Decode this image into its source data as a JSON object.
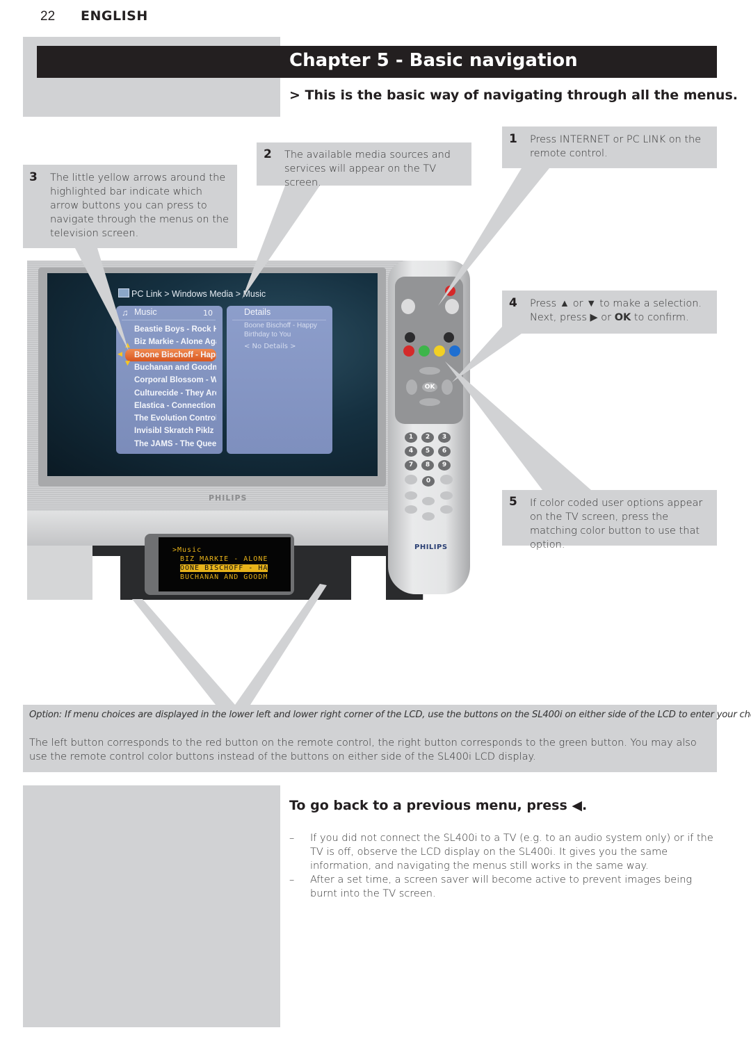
{
  "header": {
    "page_number": "22",
    "language": "ENGLISH"
  },
  "chapter": {
    "title": "Chapter 5 - Basic navigation",
    "intro": "> This is the basic way of navigating through all the menus."
  },
  "callouts": [
    {
      "number": "1",
      "text": "Press INTERNET or PC LINK on the remote control."
    },
    {
      "number": "2",
      "text": "The available media sources and services will appear on the TV screen."
    },
    {
      "number": "3",
      "text": "The little yellow arrows around the highlighted bar indicate which arrow buttons you can press to navigate through the menus on the television screen."
    },
    {
      "number": "4",
      "text_before": "Press ▲ or ▼ to make a selection. Next, press ▶ or ",
      "text_bold": "OK",
      "text_after": " to confirm."
    },
    {
      "number": "5",
      "text": "If color coded user options appear on the TV screen, press the matching color button to use that option."
    }
  ],
  "tv_screen": {
    "breadcrumb": "PC Link > Windows Media > Music",
    "menu_title": "Music",
    "menu_count": "10",
    "menu_items": [
      "Beastie Boys - Rock Hard",
      "Biz Markie - Alone Again",
      "Boone Bischoff - Happy",
      "Buchanan and Goodman",
      "Corporal Blossom - White",
      "Culturecide - They Aren't",
      "Elastica - Connection",
      "The Evolution Control Co",
      "Invisibl Skratch Piklz - u",
      "The JAMS - The Queen an"
    ],
    "selected_index": 2,
    "details_title": "Details",
    "details_text": "Boone Bischoff - Happy Birthday to You",
    "details_none": "< No Details >",
    "tv_brand": "PHILIPS"
  },
  "lcd": {
    "title": ">Music",
    "lines": [
      "BIZ MARKIE - ALONE",
      "OONE BISCHOFF - HA",
      "BUCHANAN AND GOODM"
    ],
    "selected_index": 1
  },
  "remote": {
    "brand": "PHILIPS",
    "button_colors": [
      "#d42a2a",
      "#3db54a",
      "#f2d024",
      "#1f6fd1"
    ],
    "power_color": "#d62828",
    "ok_label": "OK",
    "number_keys": [
      "1",
      "2",
      "3",
      "4",
      "5",
      "6",
      "7",
      "8",
      "9",
      "0"
    ]
  },
  "option_note": {
    "italic": "Option: If menu choices are displayed in the lower left and lower right corner of the LCD, use the buttons on the SL400i on either side of the LCD to enter your choice.",
    "text": "The left button corresponds to the red button on the remote control, the right button corresponds to the green button. You may also use the remote control color buttons instead of the buttons on either side of the SL400i LCD display."
  },
  "back_section": {
    "heading": "To go back to a previous menu, press ◀.",
    "bullets": [
      "If you did not connect the SL400i to a TV (e.g. to an audio system only) or if the TV is off, observe the LCD display on the SL400i. It gives you the same information, and navigating the menus still works in the same way.",
      "After a set time, a screen saver will become active to prevent images being burnt into the TV screen."
    ],
    "bullet_marker": "–"
  }
}
